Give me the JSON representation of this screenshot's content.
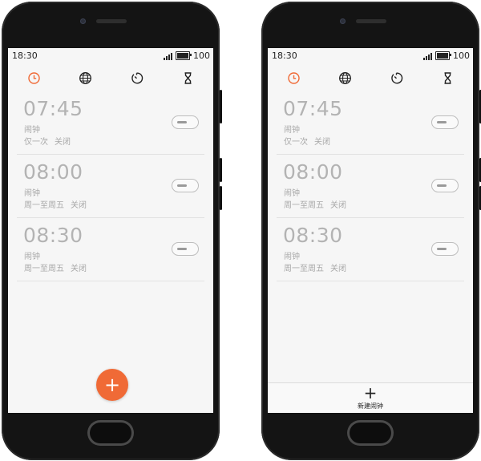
{
  "colors": {
    "accent": "#f06a36",
    "tab_icon": "#222222",
    "text_muted": "#b3b3b3"
  },
  "tabs": [
    {
      "icon": "clock-icon",
      "active": true
    },
    {
      "icon": "globe-icon",
      "active": false
    },
    {
      "icon": "stopwatch-icon",
      "active": false
    },
    {
      "icon": "hourglass-icon",
      "active": false
    }
  ],
  "phones": [
    {
      "status": {
        "time": "18:30",
        "battery": "100"
      },
      "alarms": [
        {
          "time": "07:45",
          "label": "闹钟",
          "repeat": "仅一次",
          "state": "关闭",
          "enabled": false
        },
        {
          "time": "08:00",
          "label": "闹钟",
          "repeat": "周一至周五",
          "state": "关闭",
          "enabled": false
        },
        {
          "time": "08:30",
          "label": "闹钟",
          "repeat": "周一至周五",
          "state": "关闭",
          "enabled": false
        }
      ],
      "add_button": {
        "symbol": "+"
      }
    },
    {
      "status": {
        "time": "18:30",
        "battery": "100"
      },
      "alarms": [
        {
          "time": "07:45",
          "label": "闹钟",
          "repeat": "仅一次",
          "state": "关闭",
          "enabled": false
        },
        {
          "time": "08:00",
          "label": "闹钟",
          "repeat": "周一至周五",
          "state": "关闭",
          "enabled": false
        },
        {
          "time": "08:30",
          "label": "闹钟",
          "repeat": "周一至周五",
          "state": "关闭",
          "enabled": false
        }
      ],
      "add_bar": {
        "symbol": "+",
        "label": "新建闹钟"
      }
    }
  ]
}
